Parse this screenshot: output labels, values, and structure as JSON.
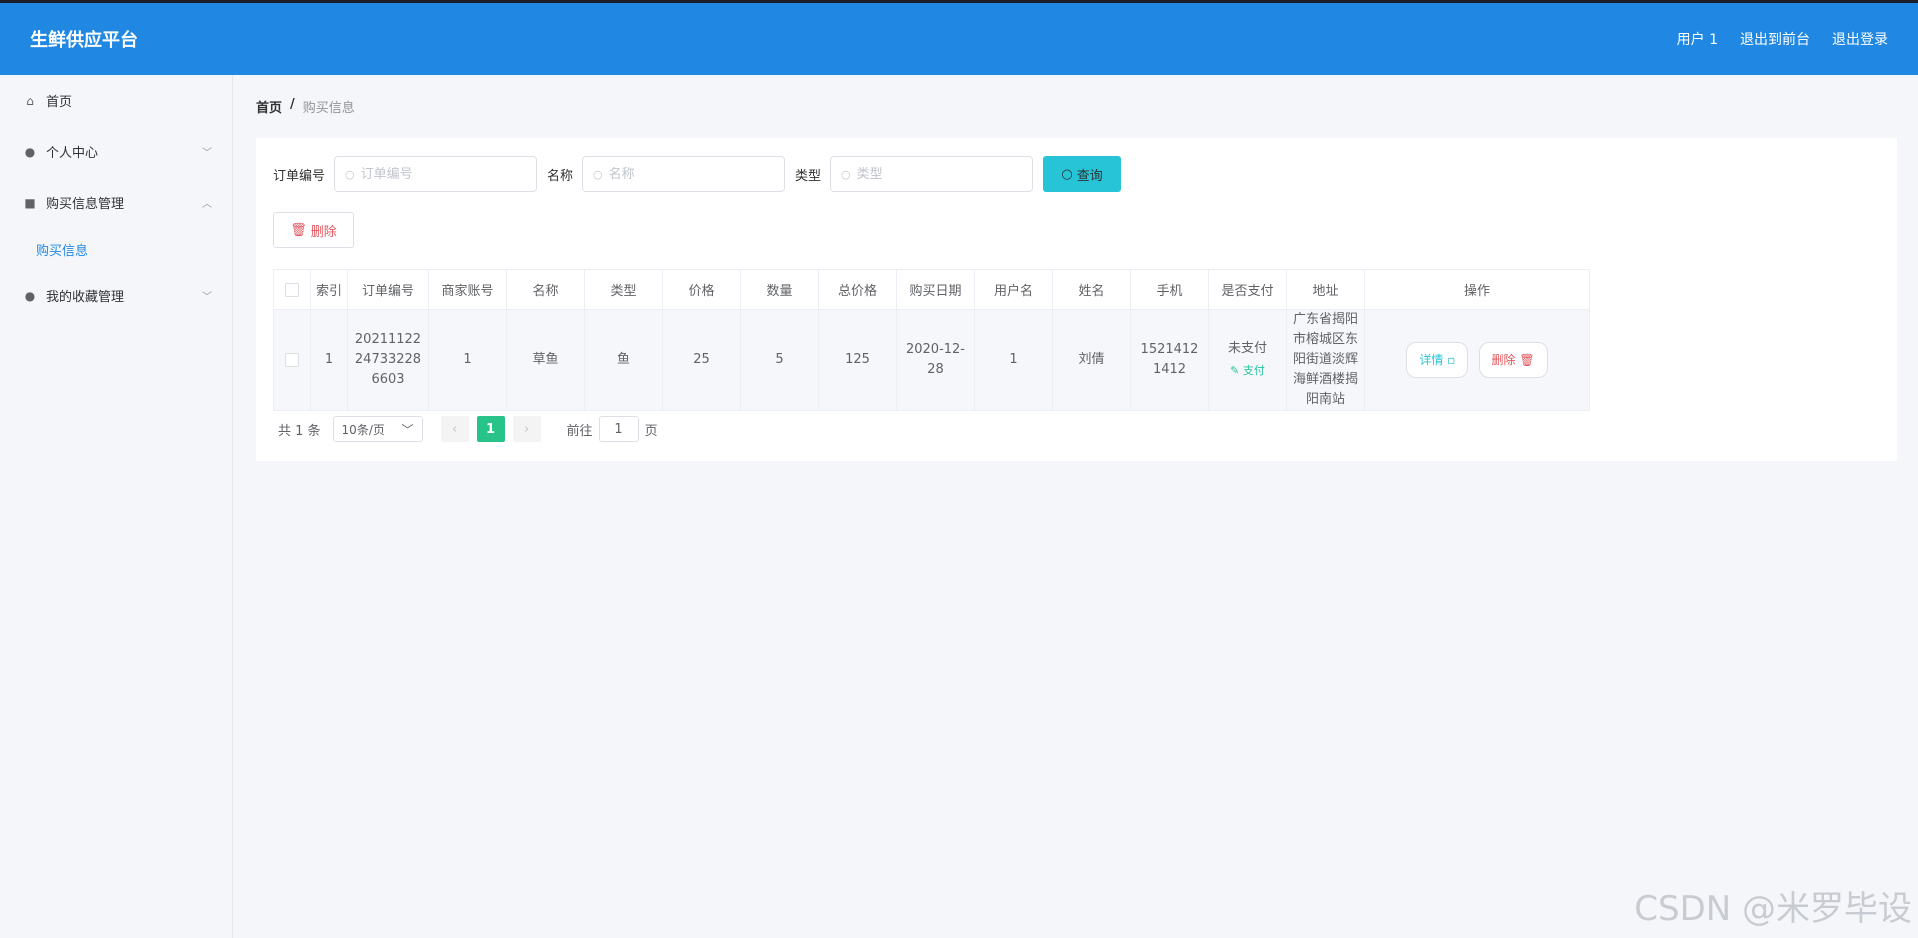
{
  "header": {
    "brand": "生鲜供应平台",
    "user": "用户 1",
    "back_front": "退出到前台",
    "logout": "退出登录"
  },
  "sidebar": {
    "items": [
      {
        "label": "首页",
        "icon": "home-icon"
      },
      {
        "label": "个人中心",
        "icon": "user-icon"
      },
      {
        "label": "购买信息管理",
        "icon": "briefcase-icon"
      },
      {
        "label": "购买信息"
      },
      {
        "label": "我的收藏管理",
        "icon": "user-icon"
      }
    ]
  },
  "breadcrumb": {
    "home": "首页",
    "sep": "/",
    "current": "购买信息"
  },
  "search": {
    "order_label": "订单编号",
    "order_placeholder": "订单编号",
    "name_label": "名称",
    "name_placeholder": "名称",
    "type_label": "类型",
    "type_placeholder": "类型",
    "query_btn": "查询"
  },
  "delete_btn": "删除",
  "table": {
    "headers": [
      "索引",
      "订单编号",
      "商家账号",
      "名称",
      "类型",
      "价格",
      "数量",
      "总价格",
      "购买日期",
      "用户名",
      "姓名",
      "手机",
      "是否支付",
      "地址",
      "操作"
    ],
    "row": {
      "index": "1",
      "order_no": "20211122247332286603",
      "merchant": "1",
      "name": "草鱼",
      "type": "鱼",
      "price": "25",
      "qty": "5",
      "total": "125",
      "date": "2020-12-28",
      "username": "1",
      "realname": "刘倩",
      "phone": "15214121412",
      "paid": "未支付",
      "pay_link": "支付",
      "address": "广东省揭阳市榕城区东阳街道淡辉海鲜酒楼揭阳南站",
      "detail_btn": "详情",
      "delete_btn": "删除"
    }
  },
  "pager": {
    "total": "共 1 条",
    "size": "10条/页",
    "current": "1",
    "goto": "前往",
    "goto_value": "1",
    "page": "页"
  },
  "watermark": "CSDN @米罗毕设"
}
